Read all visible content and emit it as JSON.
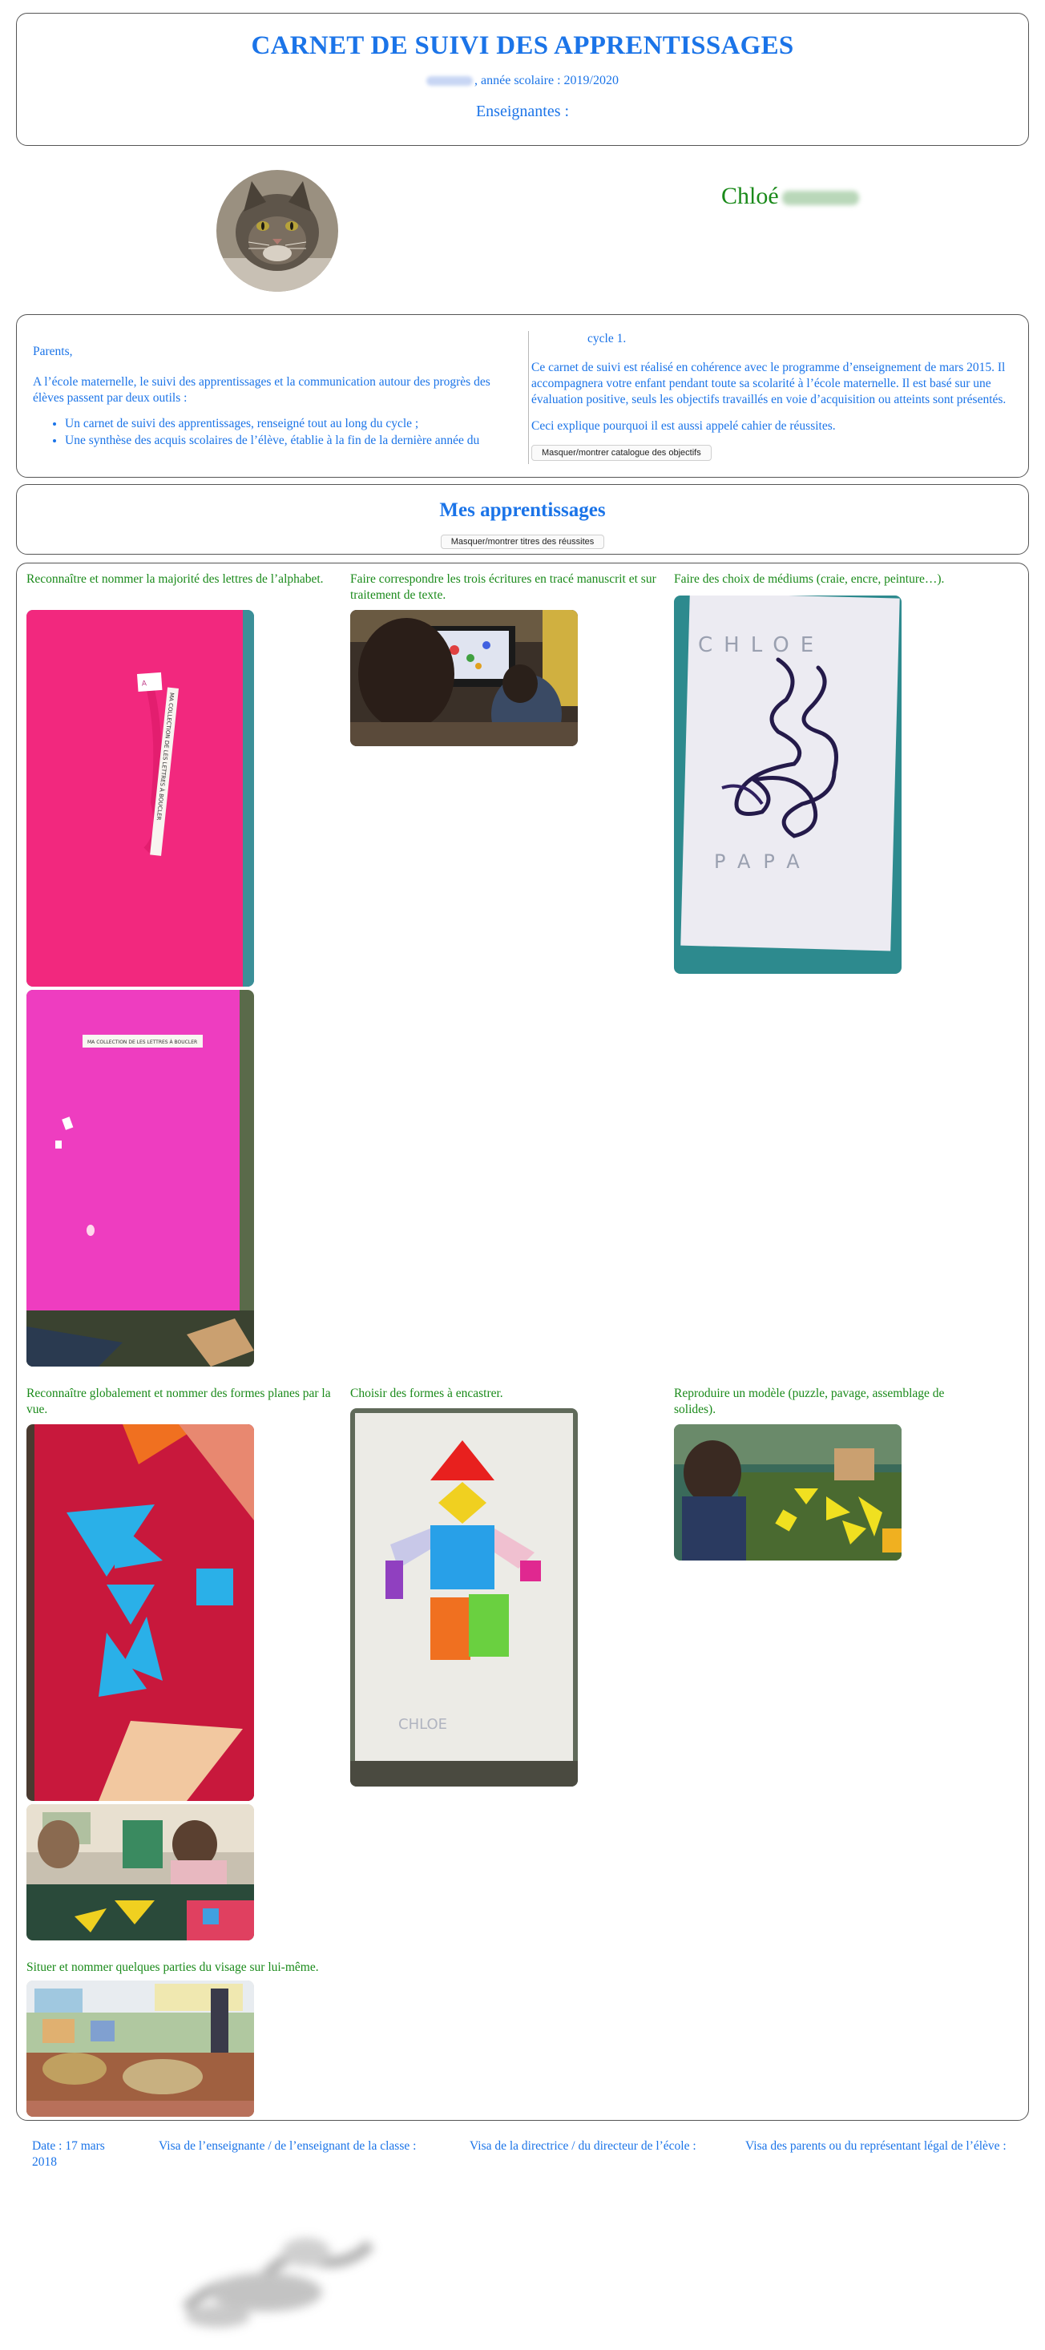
{
  "header": {
    "title": "CARNET DE SUIVI DES APPRENTISSAGES",
    "school_year": ", année scolaire : 2019/2020",
    "teachers": "Enseignantes :"
  },
  "student": {
    "first_name": "Chloé"
  },
  "intro": {
    "greeting": "Parents,",
    "paragraph1": "A l’école maternelle, le suivi des apprentissages et la communication autour des progrès des élèves passent par deux outils :",
    "bullets": [
      "Un carnet de suivi des apprentissages, renseigné tout au long du cycle ;",
      "Une synthèse des acquis scolaires de l’élève, établie à la fin de la dernière année du"
    ],
    "cycle": "cycle 1.",
    "paragraph2": "Ce carnet de suivi est réalisé en cohérence avec le programme d’enseignement de mars 2015. Il accompagnera votre enfant pendant toute sa scolarité à l’école maternelle. Il est basé sur une évaluation positive, seuls les objectifs travaillés en voie d’acquisition ou atteints sont présentés.",
    "paragraph3": "Ceci explique pourquoi il est aussi appelé cahier de réussites.",
    "toggle_catalog_label": "Masquer/montrer catalogue des objectifs"
  },
  "learning": {
    "title": "Mes apprentissages",
    "toggle_titles_label": "Masquer/montrer titres des réussites",
    "skills": [
      "Reconnaître et nommer la majorité des lettres de l’alphabet.",
      "Faire correspondre les trois écritures en tracé manuscrit et sur traitement de texte.",
      "Faire des choix de médiums (craie, encre, peinture…).",
      "Reconnaître globalement et nommer des formes planes par la vue.",
      "Choisir des formes à encastrer.",
      "Reproduire un modèle (puzzle, pavage, assemblage de solides).",
      "Situer et nommer quelques parties du visage sur lui-même."
    ],
    "photo_captions": {
      "letters_sheet": "MA COLLECTION DE LES LETTRES À BOUCLER",
      "letters_sheet_2": "MA COLLECTION DE LES LETTRES À BOUCLER",
      "name_top": "CHLOE",
      "name_bottom": "PAPA"
    }
  },
  "footer": {
    "date": "Date : 17 mars 2018",
    "visa_teacher": "Visa de l’enseignante / de l’enseignant de la classe :",
    "visa_director": "Visa de la directrice / du directeur de l’école :",
    "visa_parents": "Visa des parents ou du représentant légal de l’élève :"
  },
  "colors": {
    "primary_blue": "#1b74e8",
    "skill_green": "#1a8a1a",
    "border": "#555555"
  }
}
